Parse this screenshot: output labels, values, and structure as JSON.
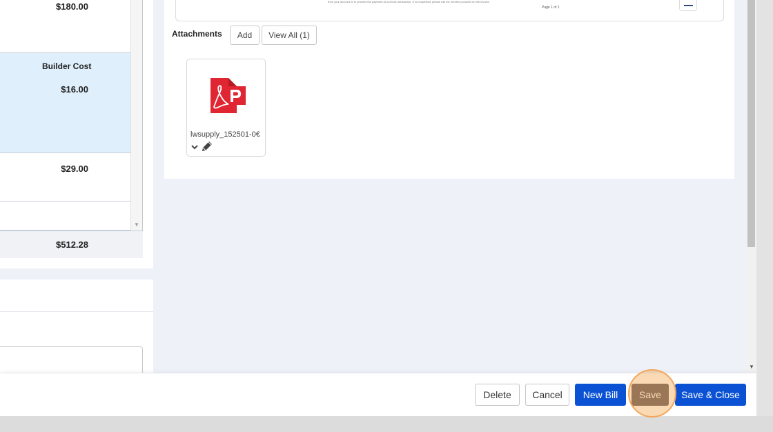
{
  "table": {
    "rows": [
      {
        "value": "$180.00"
      },
      {
        "header": "Builder Cost",
        "value": "$16.00"
      },
      {
        "value": "$29.00"
      }
    ],
    "total": "$512.28"
  },
  "preview": {
    "fine_print": "from your account or to process the payment as a check transaction. If so requested, please call the number provided on the invoice.",
    "page_label": "Page 1 of 1"
  },
  "attachments": {
    "label": "Attachments",
    "add_label": "Add",
    "view_all_label": "View All (1)",
    "files": [
      {
        "name": "lwsupply_152501-0€",
        "icon": "pdf-icon"
      }
    ]
  },
  "footer": {
    "delete_label": "Delete",
    "cancel_label": "Cancel",
    "new_bill_label": "New Bill",
    "save_label": "Save",
    "save_close_label": "Save & Close"
  },
  "colors": {
    "primary": "#0a52d3",
    "save_active": "#534b52",
    "highlight": "#f2a65a",
    "selected_row": "#dff0fc",
    "pdf_red": "#e02632"
  }
}
